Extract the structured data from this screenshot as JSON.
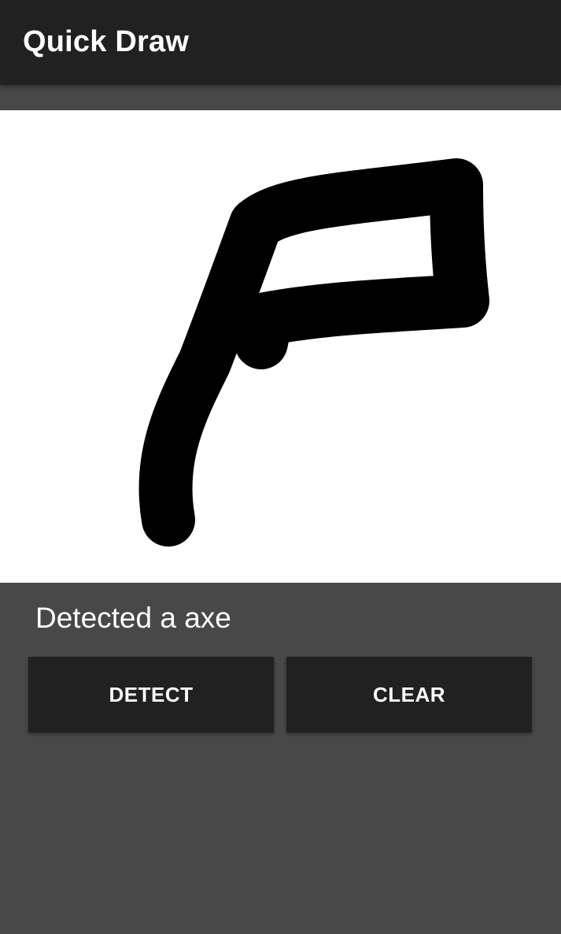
{
  "app_bar": {
    "title": "Quick Draw"
  },
  "canvas": {
    "background": "#ffffff",
    "stroke_color": "#000000"
  },
  "result": {
    "text": "Detected a axe"
  },
  "actions": {
    "detect_label": "DETECT",
    "clear_label": "CLEAR"
  },
  "colors": {
    "app_bar": "#212121",
    "background": "#484848",
    "button": "#212121",
    "text": "#ffffff"
  }
}
